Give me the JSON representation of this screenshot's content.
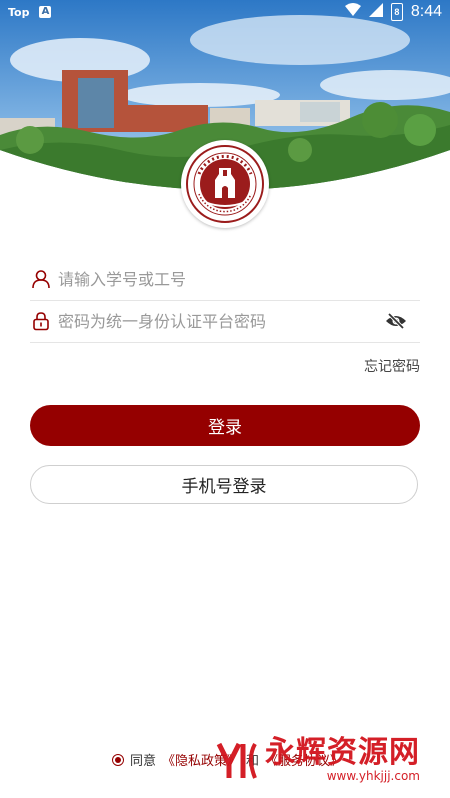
{
  "status_bar": {
    "left_label": "Top",
    "left_icon": "A",
    "battery_level": "8",
    "time": "8:44"
  },
  "login": {
    "username_placeholder": "请输入学号或工号",
    "password_placeholder": "密码为统一身份认证平台密码",
    "forgot_password": "忘记密码",
    "login_button": "登录",
    "phone_login_button": "手机号登录"
  },
  "agreement": {
    "prefix": "同意",
    "privacy_link": "《隐私政策》",
    "conjunction": "和",
    "terms_link": "《服务协议》"
  },
  "watermark": {
    "title": "永辉资源网",
    "url": "www.yhkjjj.com"
  },
  "colors": {
    "brand": "#950000",
    "watermark": "#d2141c"
  }
}
